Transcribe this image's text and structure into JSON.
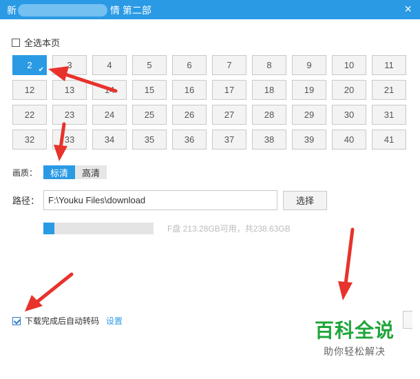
{
  "window": {
    "title_prefix": "新",
    "title_suffix": "情 第二部",
    "close_glyph": "×"
  },
  "select_all": {
    "label": "全选本页",
    "checked": false
  },
  "episodes": [
    {
      "num": "2",
      "selected": true
    },
    {
      "num": "3"
    },
    {
      "num": "4"
    },
    {
      "num": "5"
    },
    {
      "num": "6"
    },
    {
      "num": "7"
    },
    {
      "num": "8"
    },
    {
      "num": "9"
    },
    {
      "num": "10"
    },
    {
      "num": "11"
    },
    {
      "num": "12"
    },
    {
      "num": "13"
    },
    {
      "num": "14"
    },
    {
      "num": "15"
    },
    {
      "num": "16"
    },
    {
      "num": "17"
    },
    {
      "num": "18"
    },
    {
      "num": "19"
    },
    {
      "num": "20"
    },
    {
      "num": "21"
    },
    {
      "num": "22"
    },
    {
      "num": "23"
    },
    {
      "num": "24"
    },
    {
      "num": "25"
    },
    {
      "num": "26"
    },
    {
      "num": "27"
    },
    {
      "num": "28"
    },
    {
      "num": "29"
    },
    {
      "num": "30"
    },
    {
      "num": "31"
    },
    {
      "num": "32"
    },
    {
      "num": "33"
    },
    {
      "num": "34"
    },
    {
      "num": "35"
    },
    {
      "num": "36"
    },
    {
      "num": "37"
    },
    {
      "num": "38"
    },
    {
      "num": "39"
    },
    {
      "num": "40"
    },
    {
      "num": "41"
    }
  ],
  "quality": {
    "label": "画质：",
    "options": [
      "标清",
      "高清"
    ],
    "selected": "标清"
  },
  "path": {
    "label": "路径：",
    "value": "F:\\Youku Files\\download",
    "choose_label": "选择"
  },
  "disk": {
    "usage_fraction": 0.1,
    "text": "F盘 213.28GB可用，共238.63GB"
  },
  "auto_convert": {
    "label": "下载完成后自动转码",
    "checked": true,
    "settings_link": "设置"
  },
  "watermark": {
    "line1": "百科全说",
    "line2": "助你轻松解决"
  },
  "colors": {
    "accent": "#2a9ae5",
    "annotation_arrow": "#e8322c",
    "watermark_green": "#1fa53a"
  }
}
